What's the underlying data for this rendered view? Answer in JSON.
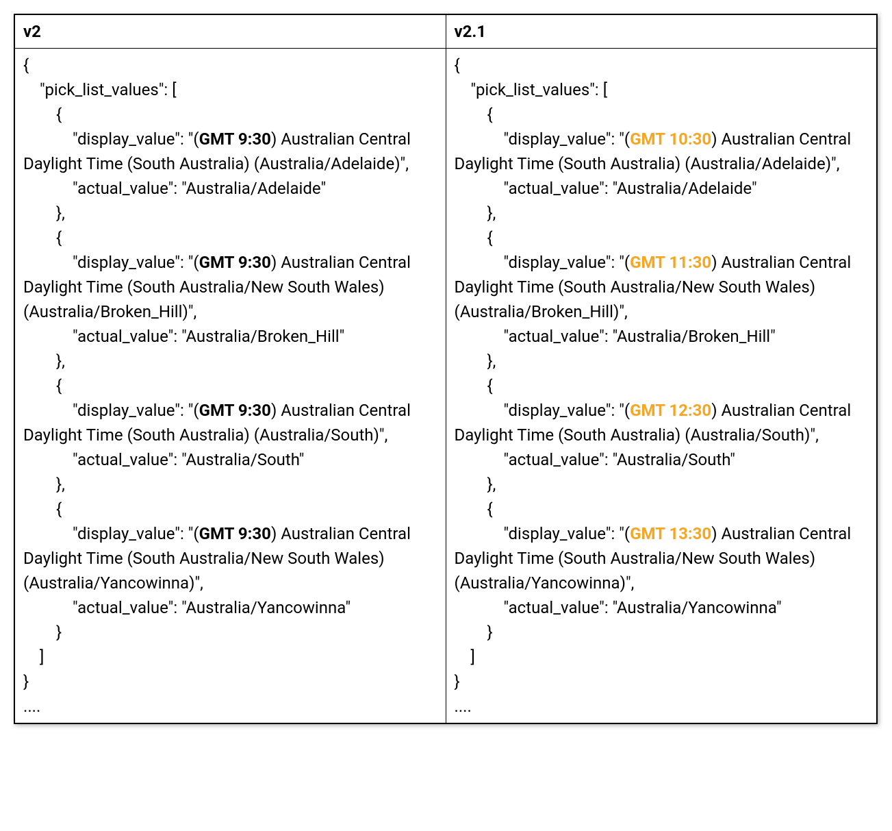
{
  "table": {
    "headers": {
      "v2": "v2",
      "v21": "v2.1"
    },
    "v2": {
      "entries": [
        {
          "gmt": "GMT 9:30",
          "desc": ") Australian Central Daylight Time (South Australia) (Australia/Adelaide)\",",
          "actual": "Australia/Adelaide"
        },
        {
          "gmt": "GMT 9:30",
          "desc": ") Australian Central Daylight Time (South Australia/New South Wales) (Australia/Broken_Hill)\",",
          "actual": "Australia/Broken_Hill"
        },
        {
          "gmt": "GMT 9:30",
          "desc": ") Australian Central Daylight Time (South Australia) (Australia/South)\",",
          "actual": "Australia/South"
        },
        {
          "gmt": "GMT 9:30",
          "desc": ") Australian Central Daylight Time (South Australia/New South Wales) (Australia/Yancowinna)\",",
          "actual": "Australia/Yancowinna"
        }
      ]
    },
    "v21": {
      "entries": [
        {
          "gmt": "GMT 10:30",
          "desc": ") Australian Central Daylight Time (South Australia) (Australia/Adelaide)\",",
          "actual": "Australia/Adelaide"
        },
        {
          "gmt": "GMT 11:30",
          "desc": ") Australian Central Daylight Time (South Australia/New South Wales) (Australia/Broken_Hill)\",",
          "actual": "Australia/Broken_Hill"
        },
        {
          "gmt": "GMT 12:30",
          "desc": ") Australian Central Daylight Time (South Australia) (Australia/South)\",",
          "actual": "Australia/South"
        },
        {
          "gmt": "GMT 13:30",
          "desc": ") Australian Central Daylight Time (South Australia/New South Wales) (Australia/Yancowinna)\",",
          "actual": "Australia/Yancowinna"
        }
      ]
    },
    "labels": {
      "open_brace": "{",
      "close_brace": "}",
      "open_bracket": "[",
      "close_bracket": "]",
      "comma": ",",
      "ellipsis": "....",
      "pick_list": "\"pick_list_values\": [",
      "display_prefix": "\"display_value\": \"(",
      "actual_prefix": "\"actual_value\": \"",
      "actual_suffix": "\"",
      "brace_comma": "},"
    }
  }
}
